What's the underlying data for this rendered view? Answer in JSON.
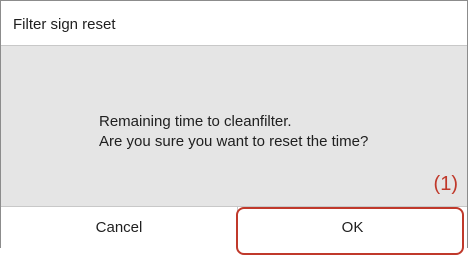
{
  "dialog": {
    "title": "Filter sign reset",
    "message_lines": [
      "Remaining time to cleanfilter.",
      "Are you sure you want to reset the time?"
    ],
    "buttons": {
      "cancel_label": "Cancel",
      "ok_label": "OK"
    }
  },
  "annotation": {
    "label": "(1)",
    "color": "#c0392b"
  }
}
